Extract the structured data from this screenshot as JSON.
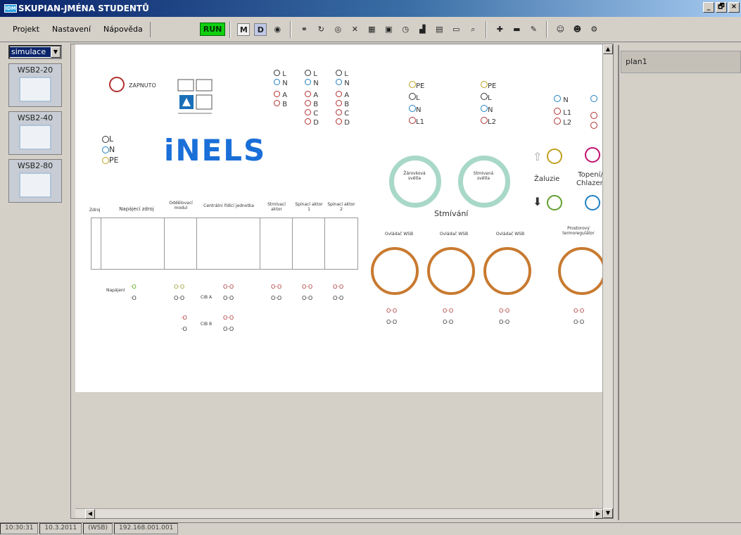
{
  "window": {
    "title": "SKUPIAN-JMÉNA STUDENTŮ",
    "icon": "app-icon",
    "controls": [
      "_",
      "🗗",
      "×"
    ]
  },
  "menu": [
    "Projekt",
    "Nastavení",
    "Nápověda"
  ],
  "toolbar": {
    "run_label": "RUN",
    "m_label": "M",
    "d_label": "D"
  },
  "sidebar": {
    "select_value": "simulace",
    "modules": [
      "WSB2-20",
      "WSB2-40",
      "WSB2-80"
    ]
  },
  "right_panel": {
    "items": [
      "plan1"
    ]
  },
  "canvas": {
    "zapnuto": "ZAPNUTO",
    "power_labels": [
      "L",
      "N",
      "PE"
    ],
    "bus_cols": [
      [
        "L",
        "N",
        "A",
        "B"
      ],
      [
        "L",
        "N",
        "A",
        "B",
        "C",
        "D"
      ],
      [
        "L",
        "N",
        "A",
        "B",
        "C",
        "D"
      ]
    ],
    "pe_cols": [
      [
        "PE",
        "L",
        "N",
        "L1"
      ],
      [
        "PE",
        "L",
        "N",
        "L2"
      ]
    ],
    "n_col": [
      "N",
      "L1",
      "L2"
    ],
    "logo": "iNELS",
    "dimmer_title": "Stmívání",
    "dimmer1": "Žárovková světla",
    "dimmer2": "Stmívaná světla",
    "zaluzie": "Žaluzie",
    "topeni": "Topení/ Chlazení",
    "rail_headers": [
      "Zdroj",
      "Napájecí zdroj",
      "Oddělovací modul",
      "Centrální řídící jednotka",
      "Stmívací aktor",
      "Spínací aktor 1",
      "Spínací aktor 2"
    ],
    "napajeni": "Napájení",
    "cib_a": "CIB A",
    "cib_b": "CIB B",
    "wsb_labels": [
      "Ovládač WSB",
      "Ovládač WSB",
      "Ovládač WSB",
      "Prostorový termoregulátor"
    ]
  },
  "statusbar": [
    "10:30:31",
    "10.3.2011",
    "(WSB)",
    "192.168.001.001"
  ],
  "colors": {
    "accent_title": "#0a246a",
    "run_green": "#10d010",
    "ring_orange": "#c87a30",
    "ring_teal": "#a8d8c8"
  }
}
